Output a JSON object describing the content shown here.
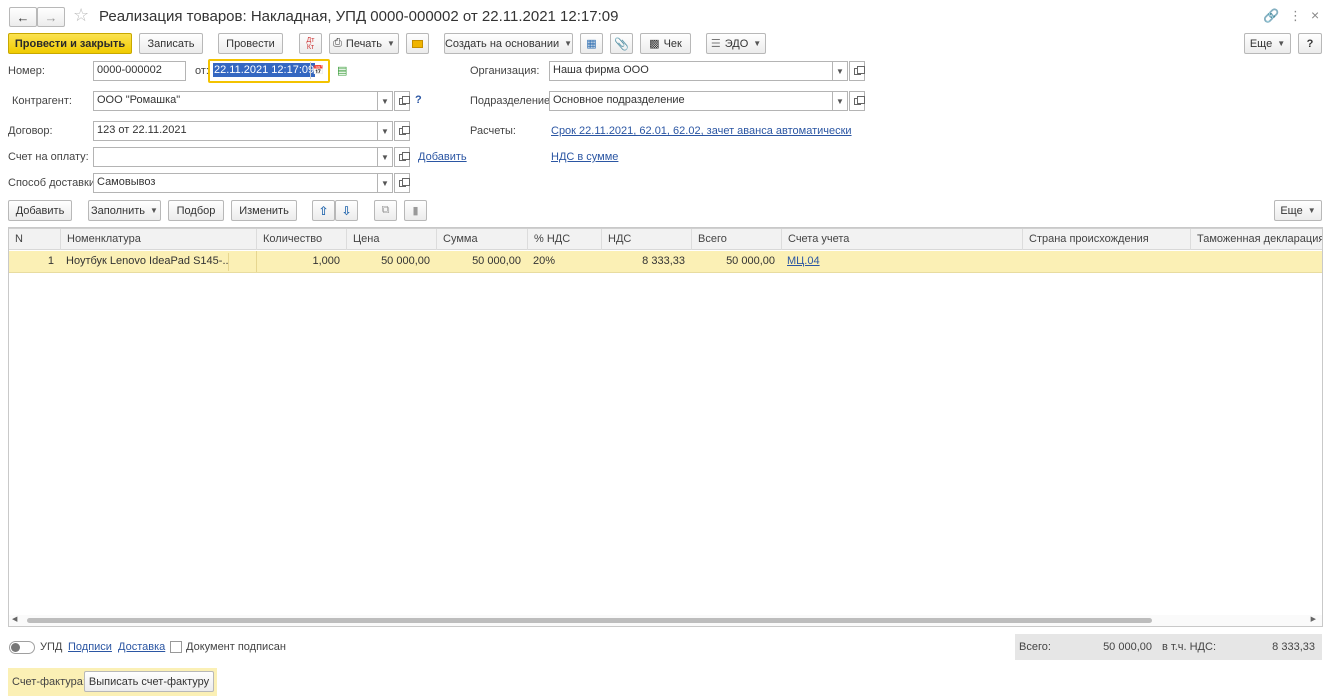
{
  "window": {
    "title": "Реализация товаров: Накладная, УПД 0000-000002 от 22.11.2021 12:17:09"
  },
  "toolbar": {
    "post_close": "Провести и закрыть",
    "save": "Записать",
    "post": "Провести",
    "dt_kt": "ДтКт",
    "print": "Печать",
    "create_based": "Создать на основании",
    "receipt": "Чек",
    "edo": "ЭДО",
    "more": "Еще",
    "help": "?"
  },
  "form": {
    "number_label": "Номер:",
    "number_value": "0000-000002",
    "date_label": "от:",
    "date_value": "22.11.2021 12:17:09",
    "org_label": "Организация:",
    "org_value": "Наша фирма ООО",
    "contractor_label": "Контрагент:",
    "contractor_value": "ООО \"Ромашка\"",
    "question": "?",
    "department_label": "Подразделение:",
    "department_value": "Основное подразделение",
    "contract_label": "Договор:",
    "contract_value": "123 от 22.11.2021",
    "settlements_label": "Расчеты:",
    "settlements_link": "Срок 22.11.2021, 62.01, 62.02, зачет аванса автоматически",
    "invoice_label": "Счет на оплату:",
    "invoice_value": "",
    "invoice_add": "Добавить",
    "vat_link": "НДС в сумме",
    "delivery_label": "Способ доставки:",
    "delivery_value": "Самовывоз"
  },
  "table_toolbar": {
    "add": "Добавить",
    "fill": "Заполнить",
    "pick": "Подбор",
    "change": "Изменить",
    "more": "Еще"
  },
  "table": {
    "columns": [
      "N",
      "Номенклатура",
      "Количество",
      "Цена",
      "Сумма",
      "% НДС",
      "НДС",
      "Всего",
      "Счета учета",
      "Страна происхождения",
      "Таможенная декларация или"
    ],
    "rows": [
      {
        "n": "1",
        "item": "Ноутбук Lenovo IdeaPad S145-...",
        "qty": "1,000",
        "price": "50 000,00",
        "sum": "50 000,00",
        "vat_rate": "20%",
        "vat": "8 333,33",
        "total": "50 000,00",
        "account": "МЦ.04",
        "country": "",
        "customs": ""
      }
    ]
  },
  "footer": {
    "upd_label": "УПД",
    "signatures": "Подписи",
    "delivery": "Доставка",
    "doc_signed": "Документ подписан",
    "total_label": "Всего:",
    "total_value": "50 000,00",
    "vat_label": "в т.ч. НДС:",
    "vat_value": "8 333,33",
    "invoice_label": "Счет-фактура:",
    "invoice_button": "Выписать счет-фактуру"
  }
}
